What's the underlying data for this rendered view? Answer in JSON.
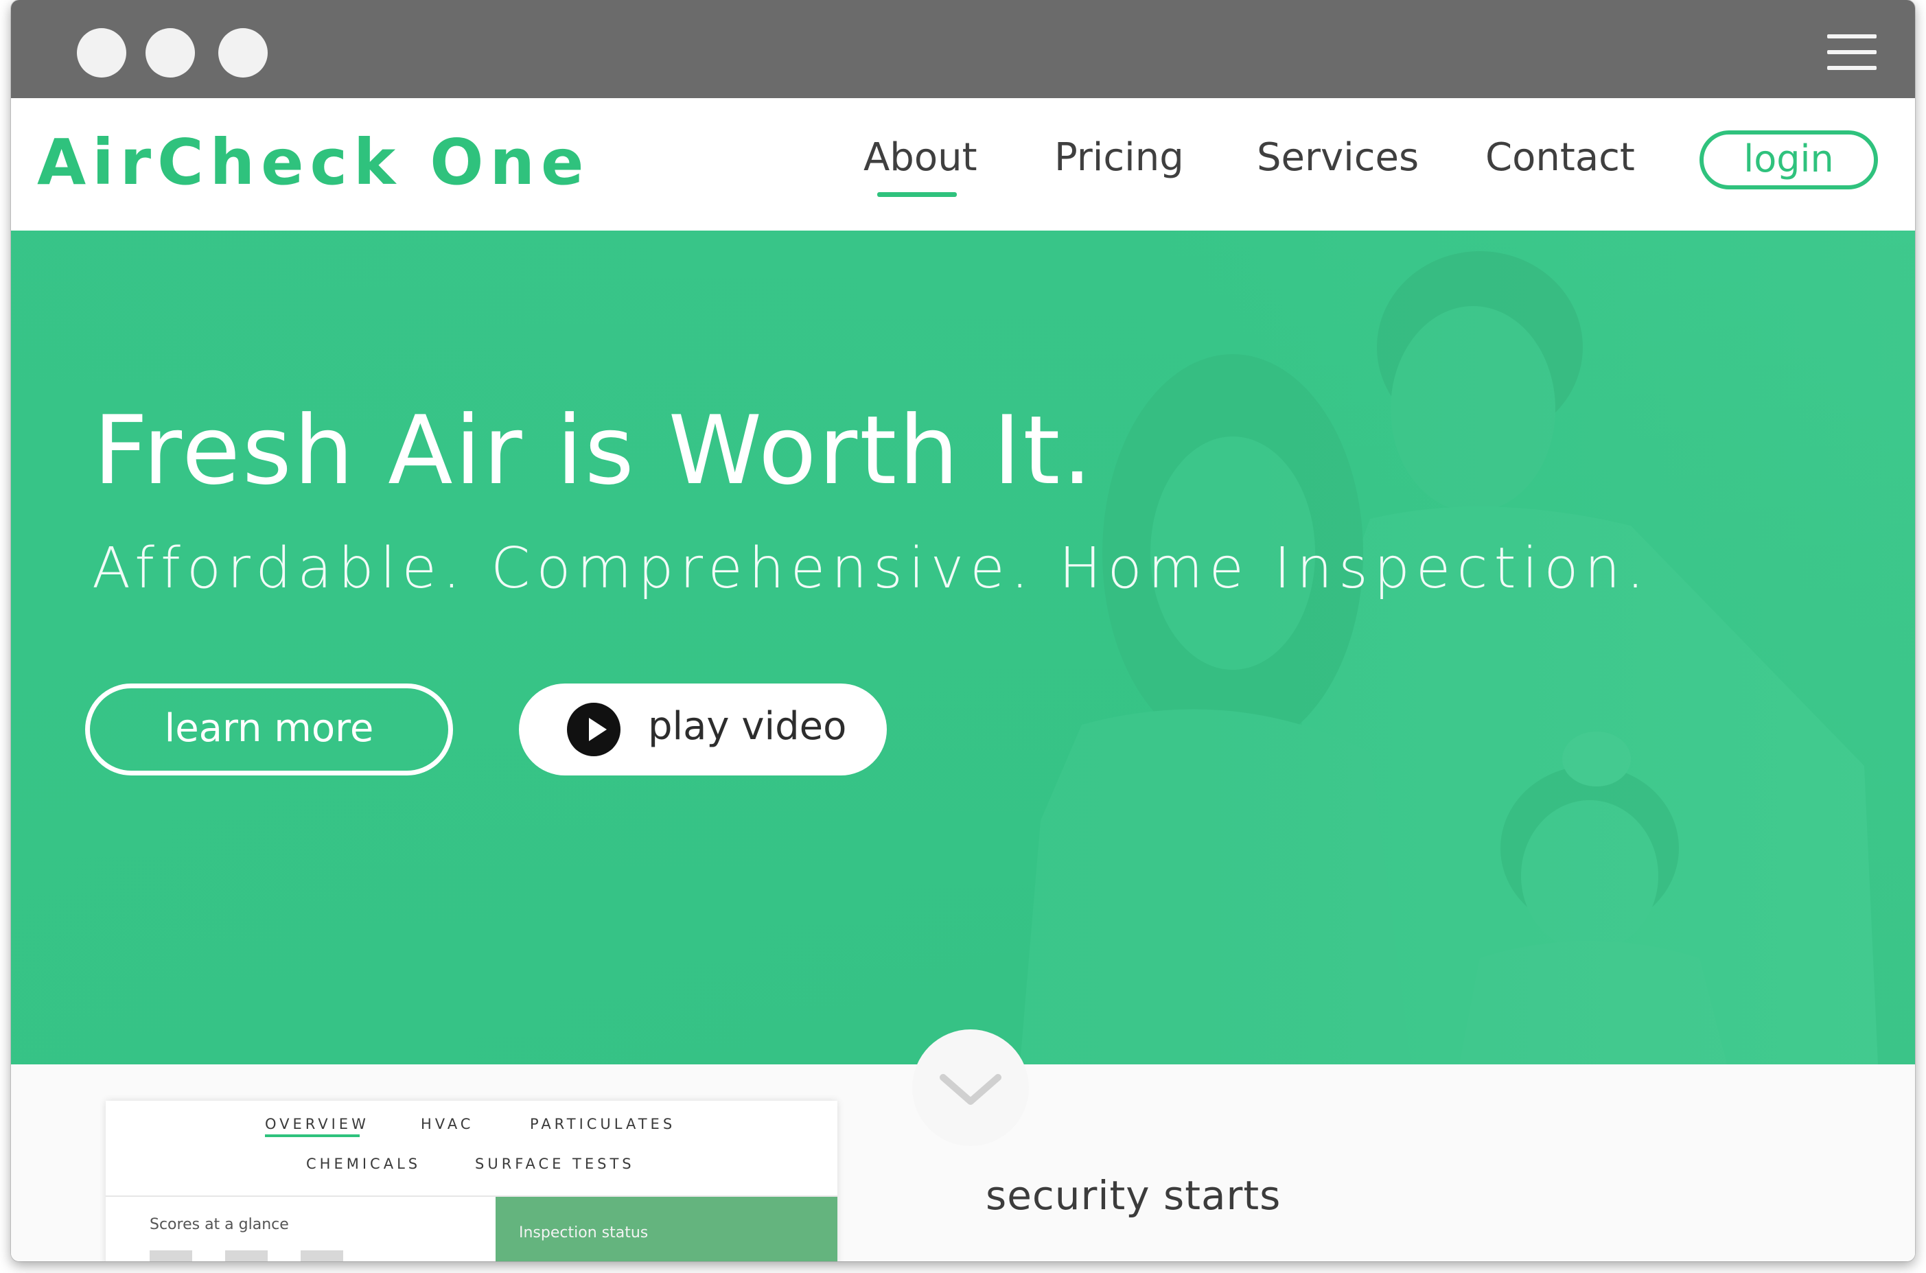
{
  "browser": {
    "window_controls": [
      "close",
      "minimize",
      "maximize"
    ],
    "menu_icon": "hamburger-menu-icon"
  },
  "header": {
    "logo": "AirCheck One",
    "nav": [
      {
        "label": "About",
        "active": true
      },
      {
        "label": "Pricing",
        "active": false
      },
      {
        "label": "Services",
        "active": false
      },
      {
        "label": "Contact",
        "active": false
      }
    ],
    "login_label": "login"
  },
  "hero": {
    "title": "Fresh Air is Worth It.",
    "subtitle": "Affordable. Comprehensive. Home Inspection.",
    "learn_more_label": "learn more",
    "play_video_label": "play video",
    "play_icon": "play-icon",
    "scroll_icon": "chevron-down-icon"
  },
  "dashboard": {
    "tabs": [
      "OVERVIEW",
      "HVAC",
      "PARTICULATES",
      "CHEMICALS",
      "SURFACE TESTS"
    ],
    "active_tab": "OVERVIEW",
    "scores_label": "Scores at a glance",
    "inspection_label": "Inspection status"
  },
  "section": {
    "tagline": "security starts"
  },
  "colors": {
    "brand_green": "#2fc27d",
    "hero_overlay": "#37c487",
    "titlebar": "#6b6b6b",
    "inspection_panel": "#64b47e"
  }
}
